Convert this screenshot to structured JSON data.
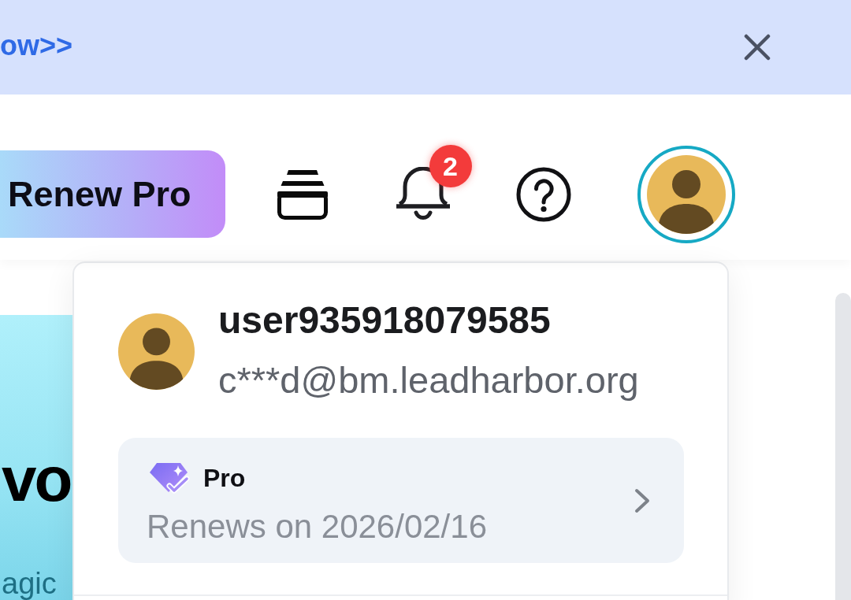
{
  "banner": {
    "link": "ow>>"
  },
  "header": {
    "renew_button": "Renew Pro",
    "notifications": {
      "badge": "2"
    }
  },
  "hero": {
    "title": "vo",
    "subtitle": "agic"
  },
  "account_menu": {
    "username": "user935918079585",
    "email": "c***d@bm.leadharbor.org",
    "plan": {
      "name": "Pro",
      "renewal": "Renews on 2026/02/16"
    }
  }
}
